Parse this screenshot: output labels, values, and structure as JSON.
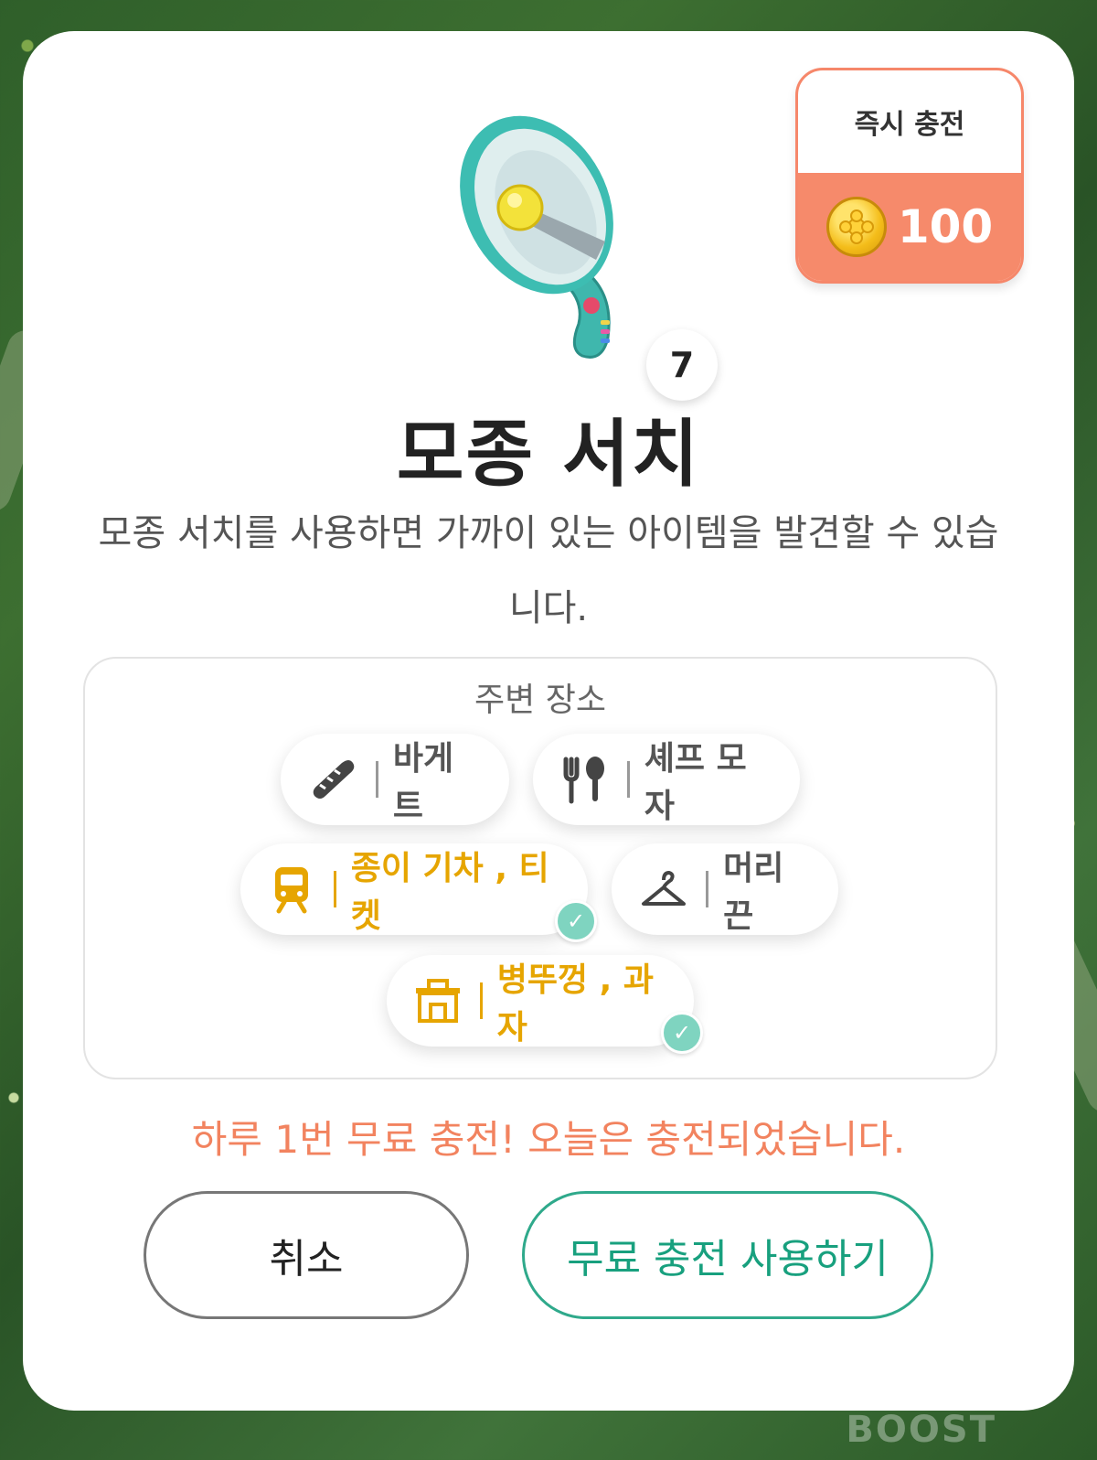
{
  "recharge": {
    "title": "즉시 충전",
    "price": "100",
    "coin_icon": "coin-icon"
  },
  "item": {
    "count": "7",
    "title": "모종 서치",
    "description": "모종 서치를 사용하면 가까이 있는 아이템을  발견할 수 있습니다.",
    "icon": "megaphone-icon"
  },
  "places": {
    "title": "주변 장소",
    "chips": [
      {
        "icon": "baguette-icon",
        "label": "바게트",
        "highlight": false,
        "checked": false
      },
      {
        "icon": "fork-spoon-icon",
        "label": "셰프 모자",
        "highlight": false,
        "checked": false
      },
      {
        "icon": "train-icon",
        "label": "종이 기차 , 티켓",
        "highlight": true,
        "checked": true
      },
      {
        "icon": "hanger-icon",
        "label": "머리끈",
        "highlight": false,
        "checked": false
      },
      {
        "icon": "shop-icon",
        "label": "병뚜껑 , 과자",
        "highlight": true,
        "checked": true
      }
    ]
  },
  "notice": "하루 1번 무료 충전! 오늘은 충전되었습니다.",
  "buttons": {
    "cancel": "취소",
    "use": "무료 충전 사용하기"
  },
  "watermark": "BOOST",
  "colors": {
    "accent": "#18a07e",
    "warning": "#f2835f",
    "highlight": "#e6a500",
    "price_bg": "#f68a6b"
  }
}
